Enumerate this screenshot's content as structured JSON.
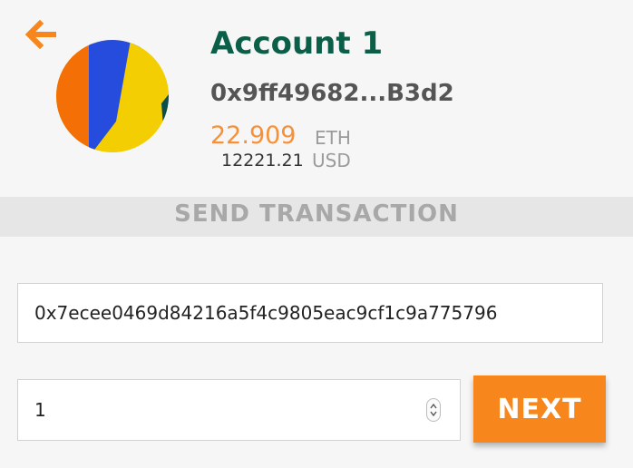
{
  "header": {
    "back_icon": "arrow-left-icon",
    "account_name": "Account 1",
    "address": "0x9ff49682...B3d2",
    "balance": {
      "eth_value": "22.909",
      "eth_unit": "ETH",
      "usd_value": "12221.21",
      "usd_unit": "USD"
    },
    "avatar_colors": [
      "#f46f05",
      "#254cdd",
      "#f3ce02",
      "#0b4f4a"
    ]
  },
  "section": {
    "title": "SEND TRANSACTION"
  },
  "form": {
    "recipient_value": "0x7ecee0469d84216a5f4c9805eac9cf1c9a775796",
    "amount_value": "1",
    "spinner_icon": "spinner-arrows-icon",
    "next_label": "NEXT"
  },
  "colors": {
    "accent": "#f7861c",
    "account_name": "#0b5e47",
    "eth_value": "#f6913a",
    "section_bar": "#e6e6e6"
  }
}
